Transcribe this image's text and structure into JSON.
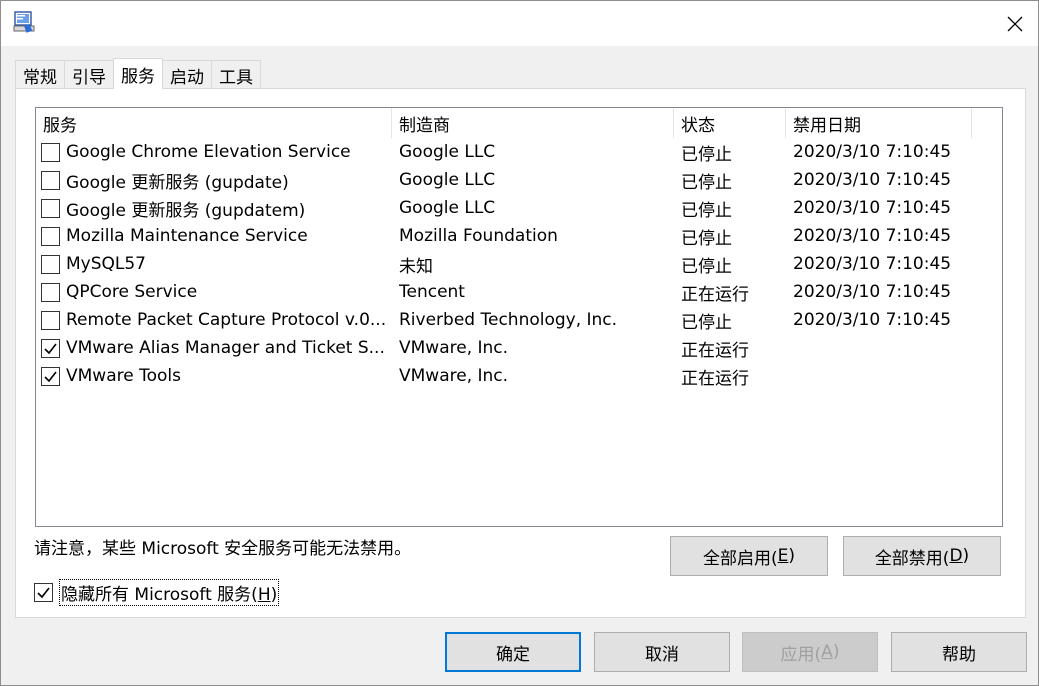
{
  "window": {
    "icon": "msconfig-icon",
    "close_symbol": "✕"
  },
  "tabs": [
    {
      "label": "常规",
      "active": false
    },
    {
      "label": "引导",
      "active": false
    },
    {
      "label": "服务",
      "active": true
    },
    {
      "label": "启动",
      "active": false
    },
    {
      "label": "工具",
      "active": false
    }
  ],
  "table": {
    "headers": [
      "服务",
      "制造商",
      "状态",
      "禁用日期"
    ],
    "rows": [
      {
        "checked": false,
        "service": "Google Chrome Elevation Service",
        "manufacturer": "Google LLC",
        "status": "已停止",
        "date": "2020/3/10 7:10:45"
      },
      {
        "checked": false,
        "service": "Google 更新服务 (gupdate)",
        "manufacturer": "Google LLC",
        "status": "已停止",
        "date": "2020/3/10 7:10:45"
      },
      {
        "checked": false,
        "service": "Google 更新服务 (gupdatem)",
        "manufacturer": "Google LLC",
        "status": "已停止",
        "date": "2020/3/10 7:10:45"
      },
      {
        "checked": false,
        "service": "Mozilla Maintenance Service",
        "manufacturer": "Mozilla Foundation",
        "status": "已停止",
        "date": "2020/3/10 7:10:45"
      },
      {
        "checked": false,
        "service": "MySQL57",
        "manufacturer": "未知",
        "status": "已停止",
        "date": "2020/3/10 7:10:45"
      },
      {
        "checked": false,
        "service": "QPCore Service",
        "manufacturer": "Tencent",
        "status": "正在运行",
        "date": "2020/3/10 7:10:45"
      },
      {
        "checked": false,
        "service": "Remote Packet Capture Protocol v.0...",
        "manufacturer": "Riverbed Technology, Inc.",
        "status": "已停止",
        "date": "2020/3/10 7:10:45"
      },
      {
        "checked": true,
        "service": "VMware Alias Manager and Ticket S...",
        "manufacturer": "VMware, Inc.",
        "status": "正在运行",
        "date": ""
      },
      {
        "checked": true,
        "service": "VMware Tools",
        "manufacturer": "VMware, Inc.",
        "status": "正在运行",
        "date": ""
      }
    ]
  },
  "note": "请注意，某些 Microsoft 安全服务可能无法禁用。",
  "enable_all": {
    "label": "全部启用(",
    "mnemonic": "E",
    "suffix": ")"
  },
  "disable_all": {
    "label": "全部禁用(",
    "mnemonic": "D",
    "suffix": ")"
  },
  "hide_ms": {
    "checked": true,
    "label": "隐藏所有 Microsoft 服务(",
    "mnemonic": "H",
    "suffix": ")"
  },
  "footer": {
    "ok": "确定",
    "cancel": "取消",
    "apply": {
      "label": "应用(",
      "mnemonic": "A",
      "suffix": ")"
    },
    "help": "帮助"
  },
  "colors": {
    "accent": "#0078d7",
    "window_bg": "#f0f0f0",
    "disabled_text": "#a0a0a0"
  }
}
